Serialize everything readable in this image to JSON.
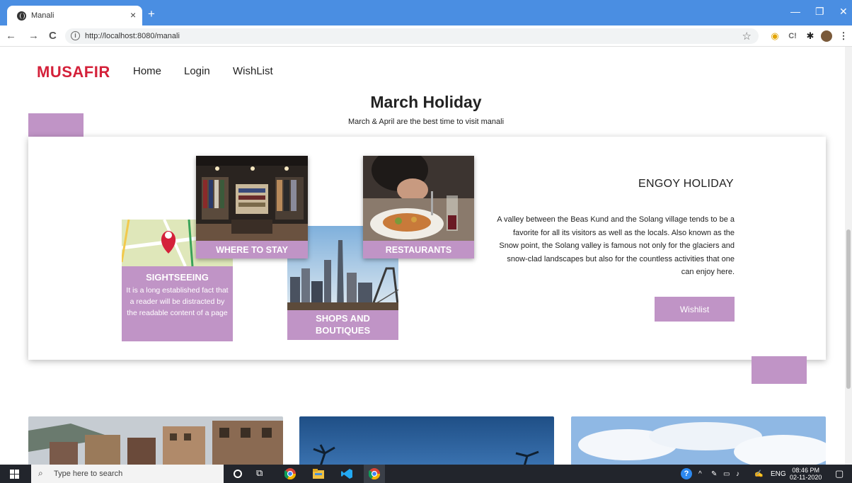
{
  "browser": {
    "tab_title": "Manali",
    "tab_close": "×",
    "new_tab": "+",
    "url": "http://localhost:8080/manali",
    "nav": {
      "back": "←",
      "forward": "→",
      "reload": "C"
    },
    "window": {
      "minimize": "—",
      "restore": "❐",
      "close": "✕"
    }
  },
  "header": {
    "brand": "MUSAFIR",
    "nav": [
      {
        "label": "Home"
      },
      {
        "label": "Login"
      },
      {
        "label": "WishList"
      }
    ]
  },
  "hero": {
    "title": "March Holiday",
    "subtitle": "March & April are the best time to visit manali"
  },
  "tiles": {
    "sightseeing": {
      "title": "SIGHTSEEING",
      "text": "It is a long established fact that a reader will be distracted by the readable content of a page"
    },
    "where_to_stay": {
      "title": "WHERE TO STAY"
    },
    "shops": {
      "title": "SHOPS AND BOUTIQUES"
    },
    "restaurants": {
      "title": "RESTAURANTS"
    }
  },
  "card": {
    "heading": "ENGOY HOLIDAY",
    "description": "A valley between the Beas Kund and the Solang village tends to be a favorite for all its visitors as well as the locals. Also known as the Snow point, the Solang valley is famous not only for the glaciers and snow-clad landscapes but also for the countless activities that one can enjoy here.",
    "button": "Wishlist"
  },
  "taskbar": {
    "search_placeholder": "Type here to search",
    "lang": "ENG",
    "time": "08:46 PM",
    "date": "02-11-2020"
  },
  "colors": {
    "accent": "#c094c6",
    "brand": "#d4213a",
    "chrome": "#4a8ee2"
  }
}
